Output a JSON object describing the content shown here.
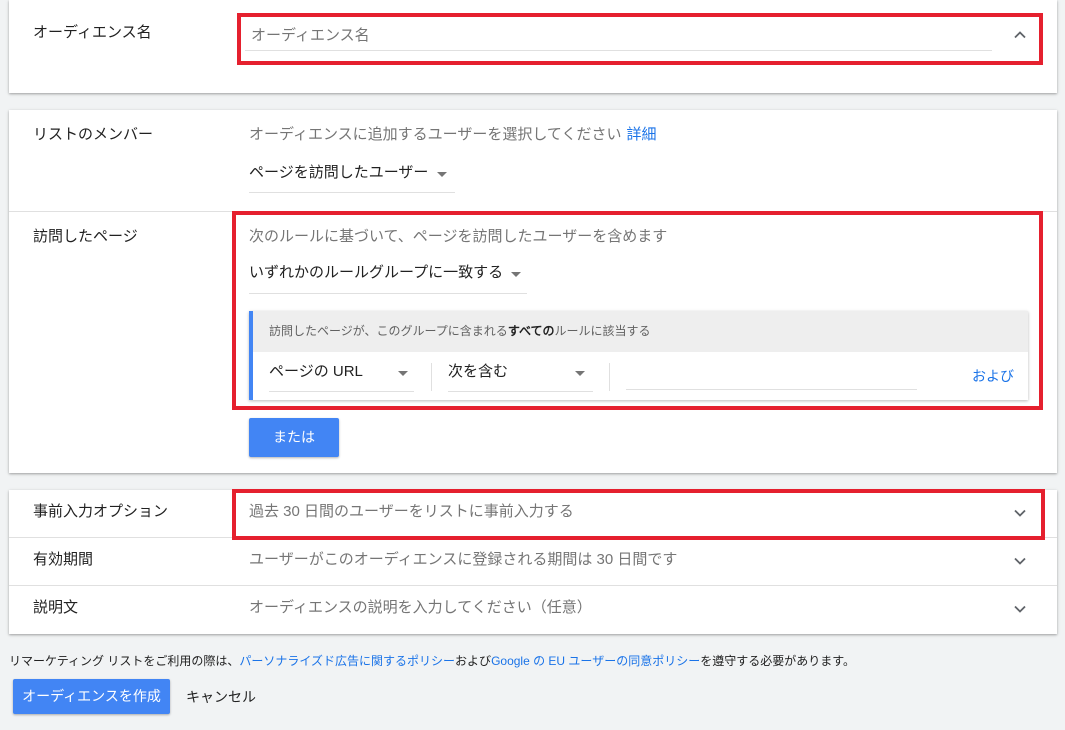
{
  "colors": {
    "background": "#f1f3f4",
    "card": "#ffffff",
    "text": "#212121",
    "secondary_text": "#757575",
    "link": "#1a73e8",
    "primary": "#4285f4",
    "divider": "#e0e0e0",
    "rule_header": "#eeeeee",
    "highlight": "#e5202e"
  },
  "icons": {
    "collapse": "chevron-up-icon",
    "expand": "chevron-down-icon",
    "dropdown": "caret-down-icon"
  },
  "audience_name": {
    "label": "オーディエンス名",
    "placeholder": "オーディエンス名"
  },
  "list_members": {
    "label": "リストのメンバー",
    "description": "オーディエンスに追加するユーザーを選択してください",
    "details_link": "詳細",
    "selected": "ページを訪問したユーザー"
  },
  "visited_pages": {
    "label": "訪問したページ",
    "description": "次のルールに基づいて、ページを訪問したユーザーを含めます",
    "match_selected": "いずれかのルールグループに一致する",
    "rule_group": {
      "header_prefix": "訪問したページが、このグループに含まれる",
      "header_bold": "すべての",
      "header_suffix": "ルールに該当する",
      "rules": [
        {
          "field": "ページの URL",
          "operator": "次を含む",
          "and_link": "および"
        }
      ]
    },
    "or_button": "または"
  },
  "options": [
    {
      "label": "事前入力オプション",
      "value": "過去 30 日間のユーザーをリストに事前入力する"
    },
    {
      "label": "有効期間",
      "value": "ユーザーがこのオーディエンスに登録される期間は 30 日間です"
    },
    {
      "label": "説明文",
      "value": "オーディエンスの説明を入力してください（任意）"
    }
  ],
  "footer": {
    "text_1": "リマーケティング リストをご利用の際は、",
    "link_1": "パーソナライズド広告に関するポリシー",
    "text_2": "および",
    "link_2": "Google の EU ユーザーの同意ポリシー",
    "text_3": "を遵守する必要があります。"
  },
  "actions": {
    "create": "オーディエンスを作成",
    "cancel": "キャンセル"
  }
}
